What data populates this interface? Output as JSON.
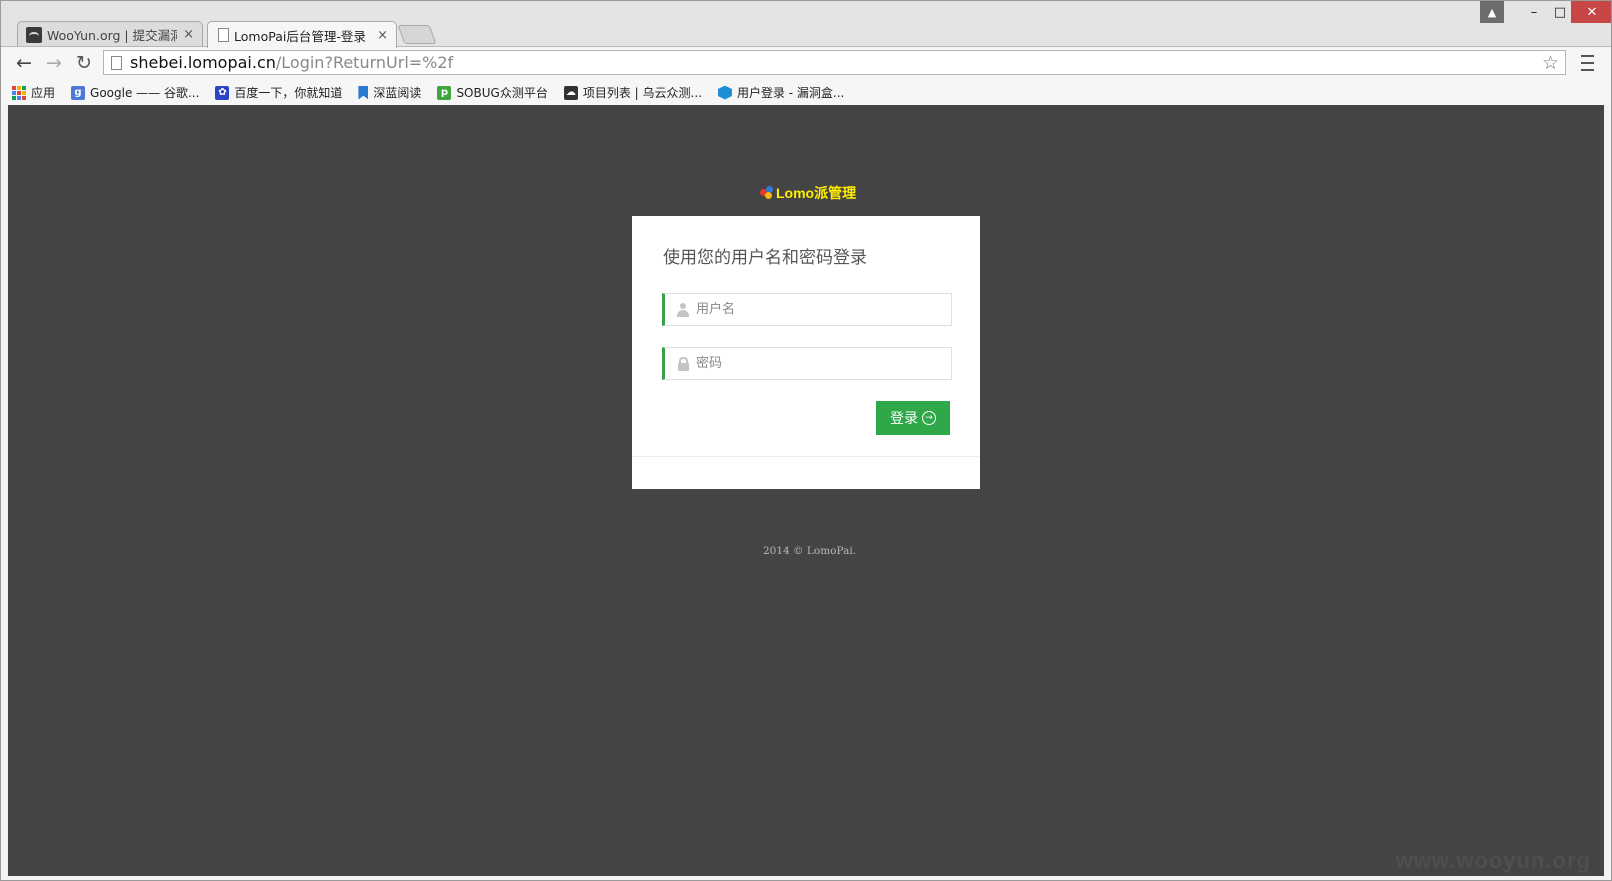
{
  "tabs": [
    {
      "title": "WooYun.org | 提交漏洞",
      "close": "×"
    },
    {
      "title": "LomoPai后台管理-登录",
      "close": "×"
    }
  ],
  "window_controls": {
    "user": "▲",
    "minimize": "–",
    "maximize": "□",
    "close": "✕"
  },
  "toolbar": {
    "back": "←",
    "forward": "→",
    "reload": "↻",
    "url_host": "shebei.lomopai.cn",
    "url_path": "/Login?ReturnUrl=%2f",
    "star": "☆"
  },
  "bookmarks": [
    {
      "label": "应用",
      "icon": "apps-icon"
    },
    {
      "label": "Google —— 谷歌...",
      "icon": "google-icon",
      "glyph": "g"
    },
    {
      "label": "百度一下，你就知道",
      "icon": "baidu-paw-icon",
      "glyph": "✿"
    },
    {
      "label": "深蓝阅读",
      "icon": "bookmark-ribbon-icon",
      "glyph": ""
    },
    {
      "label": "SOBUG众测平台",
      "icon": "sobug-icon",
      "glyph": "p"
    },
    {
      "label": "项目列表 | 乌云众测...",
      "icon": "wooyun-icon",
      "glyph": "☁"
    },
    {
      "label": "用户登录 - 漏洞盒...",
      "icon": "hexagon-icon",
      "glyph": ""
    }
  ],
  "page": {
    "brand": "Lomo派管理",
    "login_title": "使用您的用户名和密码登录",
    "username_placeholder": "用户名",
    "password_placeholder": "密码",
    "login_button": "登录",
    "footer": "2014 © LomoPai."
  },
  "watermark": "www.wooyun.org",
  "colors": {
    "page_background": "#444444",
    "brand": "#ffee00",
    "accent_green": "#2fa84a"
  }
}
